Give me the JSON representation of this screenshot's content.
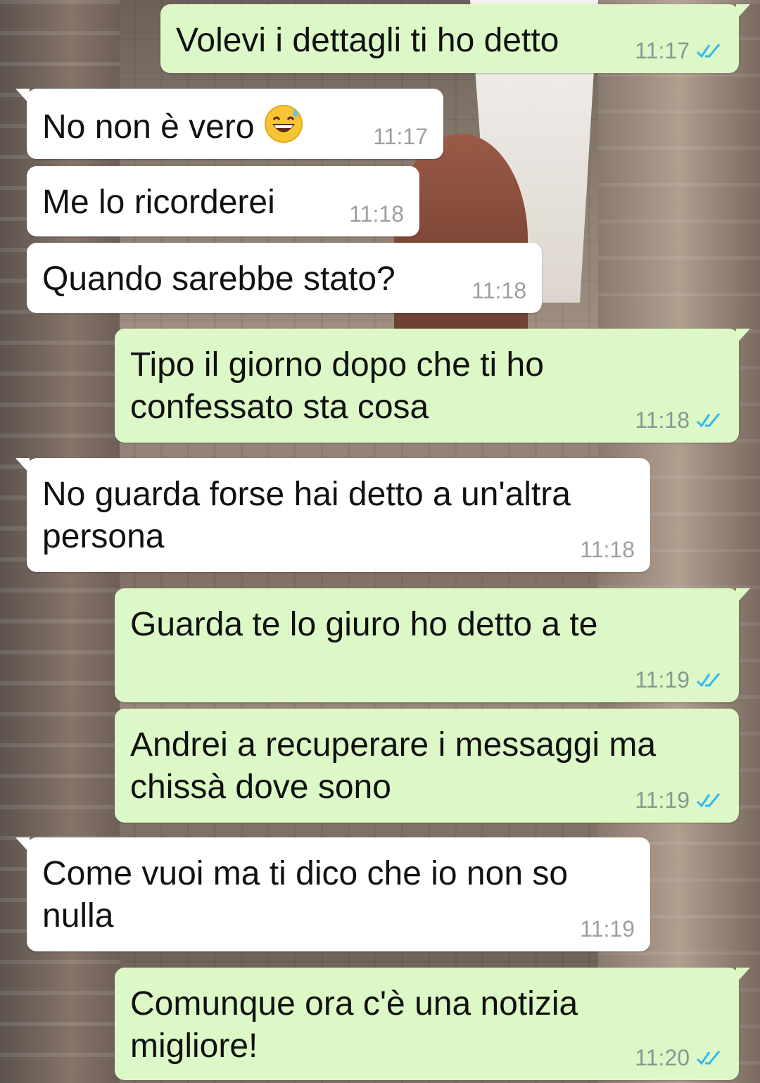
{
  "colors": {
    "incoming_bubble": "#ffffff",
    "outgoing_bubble": "#dcf8c6",
    "read_ticks": "#34b7f1"
  },
  "messages": [
    {
      "direction": "outgoing",
      "text": "Volevi i dettagli ti ho detto",
      "time": "11:17",
      "status": "read"
    },
    {
      "direction": "incoming",
      "text": "No non è vero",
      "emoji": "grinning-sweat-emoji",
      "time": "11:17"
    },
    {
      "direction": "incoming",
      "text": "Me lo ricorderei",
      "time": "11:18"
    },
    {
      "direction": "incoming",
      "text": "Quando sarebbe stato?",
      "time": "11:18"
    },
    {
      "direction": "outgoing",
      "text": "Tipo il giorno dopo che ti ho\nconfessato sta cosa",
      "time": "11:18",
      "status": "read"
    },
    {
      "direction": "incoming",
      "text": "No guarda forse hai detto a un'altra\npersona",
      "time": "11:18"
    },
    {
      "direction": "outgoing",
      "text": "Guarda te lo giuro ho detto a te",
      "time": "11:19",
      "status": "read"
    },
    {
      "direction": "outgoing",
      "text": "Andrei a recuperare i messaggi ma\nchissà dove sono",
      "time": "11:19",
      "status": "read"
    },
    {
      "direction": "incoming",
      "text": "Come vuoi ma ti dico che io non so\nnulla",
      "time": "11:19"
    },
    {
      "direction": "outgoing",
      "text": "Comunque ora c'è una notizia\nmigliore!",
      "time": "11:20",
      "status": "read"
    }
  ]
}
